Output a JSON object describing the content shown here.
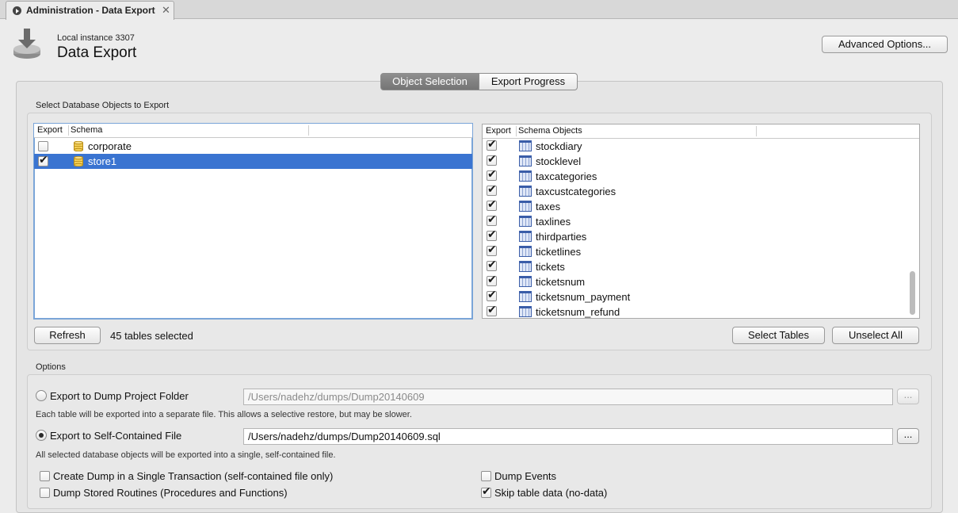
{
  "tab": {
    "title": "Administration - Data Export",
    "close": "✕"
  },
  "header": {
    "subtitle": "Local instance 3307",
    "title": "Data Export",
    "advanced_button": "Advanced Options..."
  },
  "segments": {
    "active": "Object Selection",
    "inactive": "Export Progress"
  },
  "selection": {
    "group_label": "Select Database Objects to Export",
    "left_columns": [
      "Export",
      "Schema"
    ],
    "schemas": [
      {
        "name": "corporate",
        "checked": false,
        "selected": false
      },
      {
        "name": "store1",
        "checked": true,
        "selected": true
      }
    ],
    "right_columns": [
      "Export",
      "Schema Objects"
    ],
    "objects": [
      {
        "name": "stockdiary",
        "checked": true
      },
      {
        "name": "stocklevel",
        "checked": true
      },
      {
        "name": "taxcategories",
        "checked": true
      },
      {
        "name": "taxcustcategories",
        "checked": true
      },
      {
        "name": "taxes",
        "checked": true
      },
      {
        "name": "taxlines",
        "checked": true
      },
      {
        "name": "thirdparties",
        "checked": true
      },
      {
        "name": "ticketlines",
        "checked": true
      },
      {
        "name": "tickets",
        "checked": true
      },
      {
        "name": "ticketsnum",
        "checked": true
      },
      {
        "name": "ticketsnum_payment",
        "checked": true
      },
      {
        "name": "ticketsnum_refund",
        "checked": true
      }
    ],
    "refresh_button": "Refresh",
    "count_text": "45 tables selected",
    "select_tables_button": "Select Tables",
    "unselect_all_button": "Unselect All"
  },
  "options": {
    "group_label": "Options",
    "folder_label": "Export to Dump Project Folder",
    "folder_path": "/Users/nadehz/dumps/Dump20140609",
    "folder_hint": "Each table will be exported into a separate file. This allows a selective restore, but may be slower.",
    "file_label": "Export to Self-Contained File",
    "file_path": "/Users/nadehz/dumps/Dump20140609.sql",
    "file_hint": "All selected database objects will be exported into a single, self-contained file.",
    "browse_label": "...",
    "selected_mode": "file",
    "checks": [
      {
        "label": "Create Dump in a Single Transaction (self-contained file only)",
        "checked": false
      },
      {
        "label": "Dump Stored Routines (Procedures and Functions)",
        "checked": false
      },
      {
        "label": "Dump Events",
        "checked": false
      },
      {
        "label": "Skip table data (no-data)",
        "checked": true
      }
    ]
  },
  "colors": {
    "selection": "#3a74d1",
    "focus": "#7aa5d8"
  }
}
